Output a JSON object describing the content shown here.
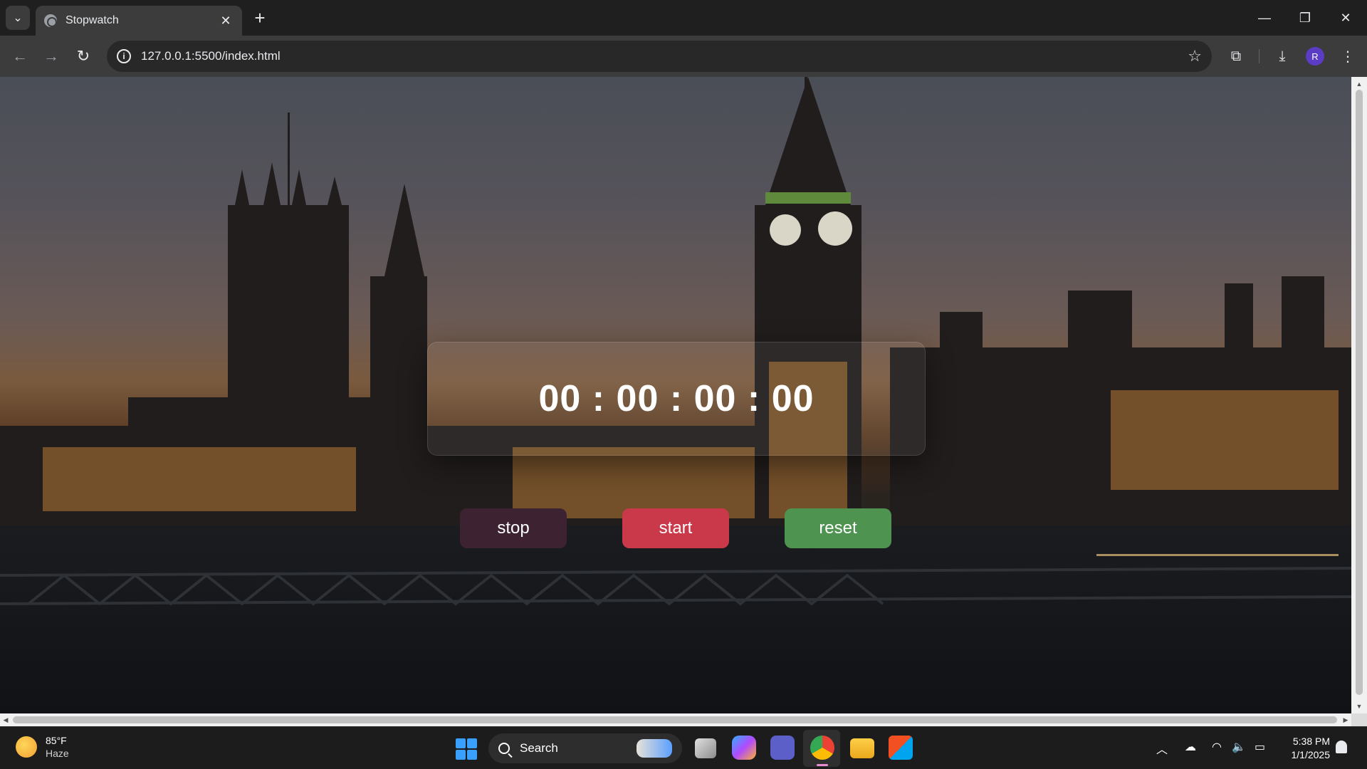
{
  "browser": {
    "tab_title": "Stopwatch",
    "tab_close": "✕",
    "new_tab": "+",
    "url": "127.0.0.1:5500/index.html",
    "profile_initial": "R",
    "window_controls": {
      "minimize": "—",
      "restore": "❐",
      "close": "✕"
    },
    "icons": [
      "tab-search-icon",
      "globe-icon",
      "back-arrow-icon",
      "forward-arrow-icon",
      "reload-icon",
      "site-info-icon",
      "bookmark-star-icon",
      "extensions-icon",
      "download-icon",
      "more-menu-icon"
    ]
  },
  "page": {
    "timer": {
      "hours": "00",
      "minutes": "00",
      "seconds": "00",
      "centiseconds": "00",
      "separator": ":"
    },
    "buttons": {
      "stop": "stop",
      "start": "start",
      "reset": "reset"
    },
    "colors": {
      "stop": "#3d2232",
      "start": "#c9394a",
      "reset": "#4f9350"
    }
  },
  "taskbar": {
    "weather_temp": "85°F",
    "weather_condition": "Haze",
    "search_label": "Search",
    "time": "5:38 PM",
    "date": "1/1/2025"
  }
}
